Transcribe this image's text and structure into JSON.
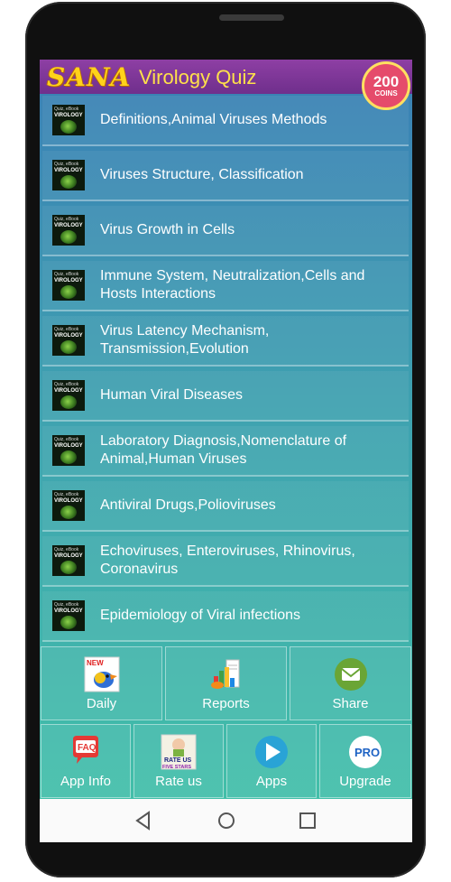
{
  "header": {
    "brand": "SANA",
    "title": "Virology Quiz",
    "coins_value": "200",
    "coins_label": "COINS"
  },
  "thumbnail": {
    "line1": "Quiz, eBook",
    "line2": "VIROLOGY"
  },
  "chapters": [
    "Definitions,Animal Viruses Methods",
    "Viruses Structure, Classification",
    "Virus Growth in Cells",
    "Immune System, Neutralization,Cells and Hosts Interactions",
    "Virus Latency Mechanism, Transmission,Evolution",
    "Human Viral Diseases",
    "Laboratory Diagnosis,Nomenclature of Animal,Human Viruses",
    "Antiviral Drugs,Polioviruses",
    "Echoviruses, Enteroviruses, Rhinovirus, Coronavirus",
    "Epidemiology of Viral infections"
  ],
  "bottom_row1": {
    "daily": "Daily",
    "daily_badge": "NEW",
    "reports": "Reports",
    "share": "Share"
  },
  "bottom_row2": {
    "app_info": "App Info",
    "faq_badge": "FAQ",
    "rate_us": "Rate us",
    "rate_badge_line1": "RATE US",
    "rate_badge_line2": "FIVE STARS",
    "apps": "Apps",
    "upgrade": "Upgrade",
    "pro_badge": "PRO"
  },
  "colors": {
    "header_purple": "#7a3396",
    "brand_yellow": "#ffd21a",
    "coins_pink": "#e54b6b",
    "list_blue": "#3a7fb5",
    "list_teal": "#42c2a8"
  }
}
